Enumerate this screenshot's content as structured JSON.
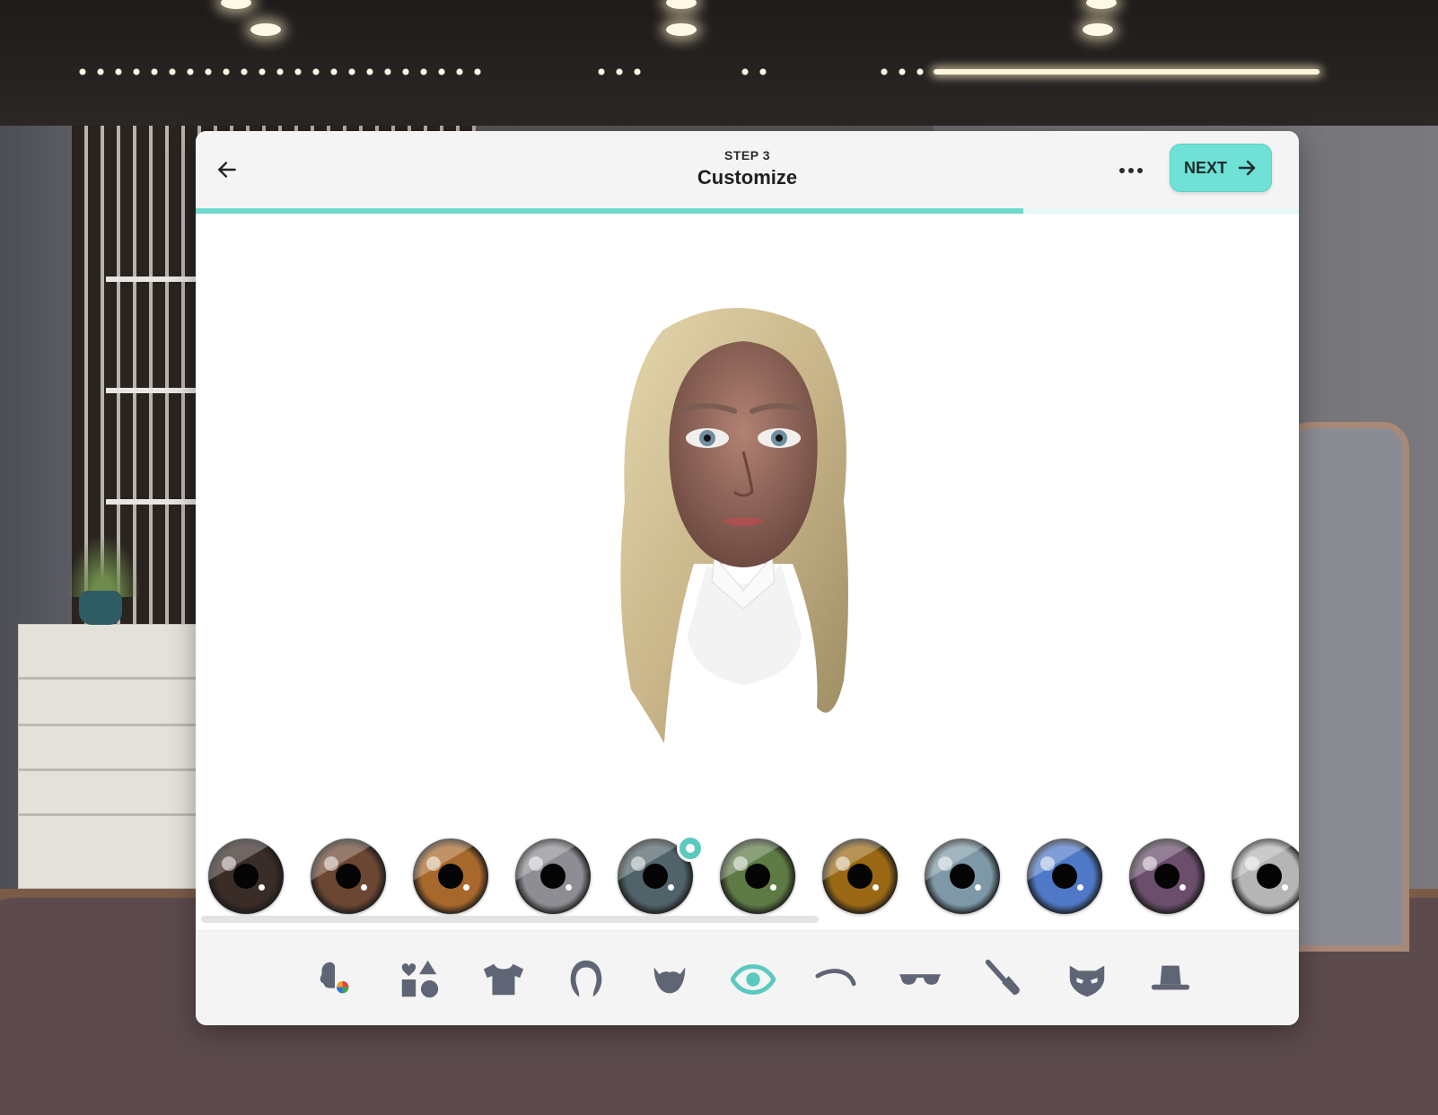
{
  "header": {
    "step_label": "STEP 3",
    "title": "Customize",
    "next_label": "NEXT",
    "back_icon": "arrow-left-icon",
    "more_icon": "more-horizontal-icon",
    "next_icon": "arrow-right-icon"
  },
  "progress": {
    "fraction": 0.75,
    "color": "#6fd9cf"
  },
  "accent_color": "#6fe1d6",
  "eye_colors": {
    "selected_index": 4,
    "swatches": [
      {
        "name": "dark-brown",
        "color": "#3a2c26"
      },
      {
        "name": "brown",
        "color": "#6b4632"
      },
      {
        "name": "hazel",
        "color": "#a8682b"
      },
      {
        "name": "gray",
        "color": "#8d8d93"
      },
      {
        "name": "blue-gray",
        "color": "#51636a"
      },
      {
        "name": "green",
        "color": "#5e7b45"
      },
      {
        "name": "amber",
        "color": "#9a6814"
      },
      {
        "name": "light-blue",
        "color": "#7d98a6"
      },
      {
        "name": "blue",
        "color": "#4f79c6"
      },
      {
        "name": "violet",
        "color": "#6a4e6c"
      },
      {
        "name": "silver",
        "color": "#b5b5b5"
      }
    ]
  },
  "categories": [
    {
      "icon": "skin-tone-icon",
      "active": false
    },
    {
      "icon": "shapes-icon",
      "active": false
    },
    {
      "icon": "shirt-icon",
      "active": false
    },
    {
      "icon": "hair-icon",
      "active": false
    },
    {
      "icon": "beard-icon",
      "active": false
    },
    {
      "icon": "eye-icon",
      "active": true
    },
    {
      "icon": "eyebrow-icon",
      "active": false
    },
    {
      "icon": "glasses-icon",
      "active": false
    },
    {
      "icon": "makeup-brush-icon",
      "active": false
    },
    {
      "icon": "mask-icon",
      "active": false
    },
    {
      "icon": "hat-icon",
      "active": false
    }
  ]
}
